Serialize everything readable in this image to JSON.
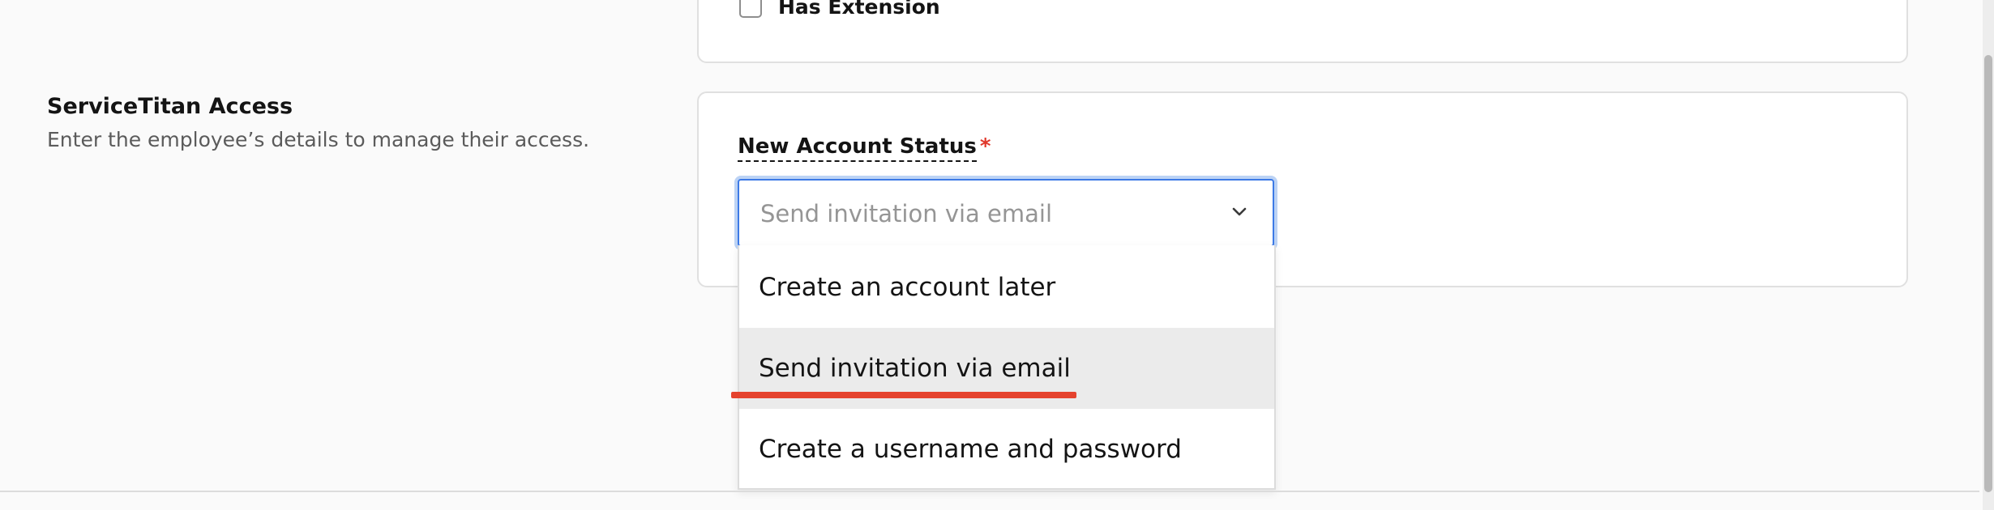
{
  "previous_section": {
    "checkbox_label": "Has Extension"
  },
  "access_section": {
    "title": "ServiceTitan Access",
    "description": "Enter the employee’s details to manage their access."
  },
  "account_status": {
    "label": "New Account Status",
    "required_mark": "*",
    "selected_value": "Send invitation via email",
    "options": [
      "Create an account later",
      "Send invitation via email",
      "Create a username and password"
    ],
    "highlighted_index": 1
  },
  "colors": {
    "focus_border": "#3d7ae6",
    "required": "#e0372a",
    "annotation": "#e5432e",
    "hover_option": "#ebebeb"
  }
}
